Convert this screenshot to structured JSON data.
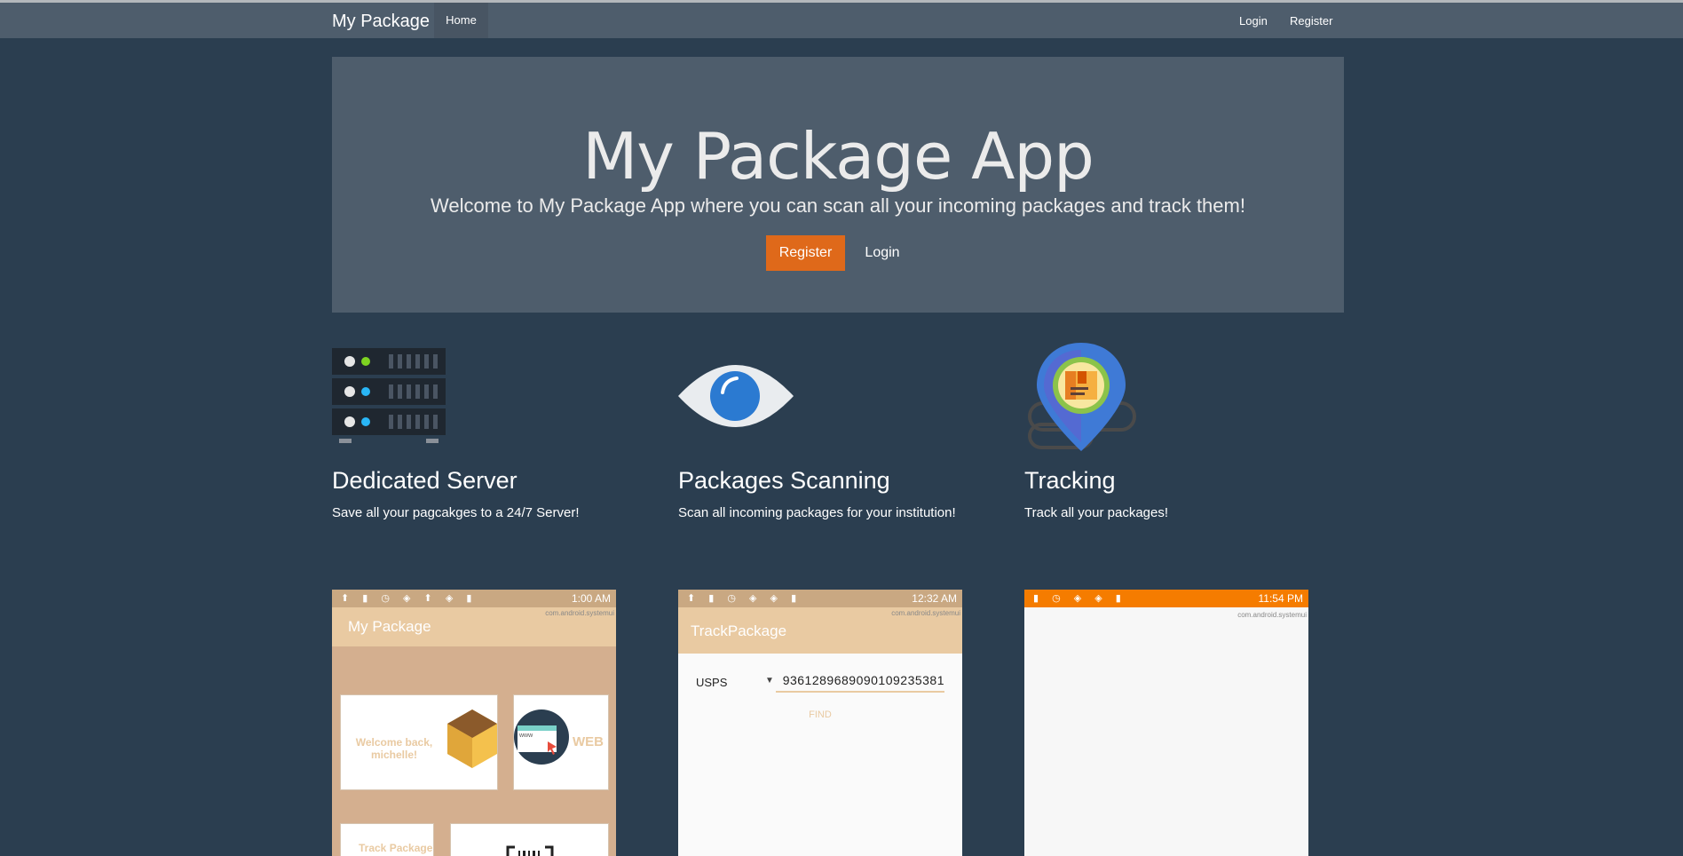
{
  "nav": {
    "brand": "My Package",
    "home": "Home",
    "login": "Login",
    "register": "Register"
  },
  "hero": {
    "title": "My Package App",
    "subtitle": "Welcome to My Package App where you can scan all your incoming packages and track them!",
    "register_label": "Register",
    "login_label": "Login"
  },
  "features": [
    {
      "title": "Dedicated Server",
      "text": "Save all your pagcakges to a 24/7 Server!",
      "icon": "server-icon"
    },
    {
      "title": "Packages Scanning",
      "text": "Scan all incoming packages for your institution!",
      "icon": "eye-icon"
    },
    {
      "title": "Tracking",
      "text": "Track all your packages!",
      "icon": "map-pin-icon"
    }
  ],
  "screenshots": [
    {
      "status_time": "1:00 AM",
      "status_note": "com.android.systemui",
      "app_title": "My Package",
      "welcome": "Welcome back, michelle!",
      "web_label": "WEB",
      "www": "www",
      "track_label": "Track Package"
    },
    {
      "status_time": "12:32 AM",
      "status_note": "com.android.systemui",
      "app_title": "TrackPackage",
      "carrier": "USPS",
      "tracking_number": "9361289689090109235381",
      "find_label": "FIND"
    },
    {
      "status_time": "11:54 PM",
      "status_note": "com.android.systemui"
    }
  ],
  "colors": {
    "background": "#2b3e50",
    "navbar": "#4e5d6c",
    "accent": "#df691a"
  }
}
